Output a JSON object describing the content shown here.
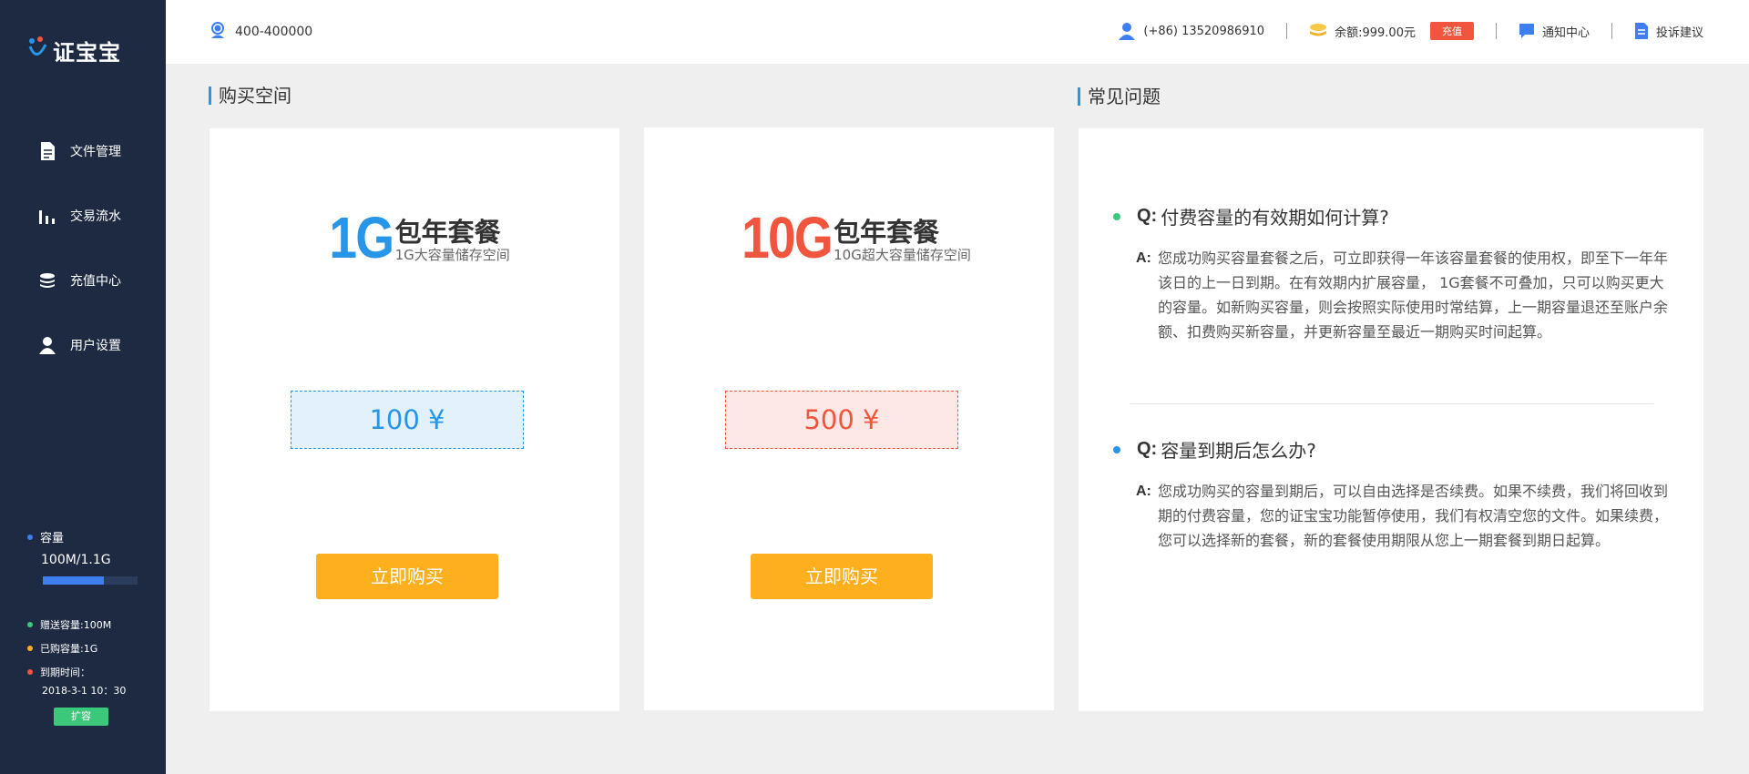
{
  "brand": {
    "name": "证宝宝"
  },
  "sidebar": {
    "items": [
      {
        "label": "文件管理",
        "icon": "document-icon"
      },
      {
        "label": "交易流水",
        "icon": "bar-chart-icon"
      },
      {
        "label": "充值中心",
        "icon": "coins-icon"
      },
      {
        "label": "用户设置",
        "icon": "user-icon"
      }
    ],
    "capacity": {
      "title": "容量",
      "value": "100M/1.1G",
      "used_fraction": 0.64,
      "gift": "赠送容量:100M",
      "purchased": "已购容量:1G",
      "expire_label": "到期时间：",
      "expire_value": "2018-3-1 10：30",
      "expand_label": "扩容"
    },
    "colors": {
      "background": "#1e2a42",
      "gift_dot": "#3cc87a",
      "purchased_dot": "#fdaf1d",
      "expire_dot": "#f2553d",
      "capacity_dot": "#3e7ef0"
    }
  },
  "header": {
    "hotline": "400-400000",
    "phone": "(+86)  13520986910",
    "balance": "余额:999.00元",
    "recharge_label": "充值",
    "notifications": "通知中心",
    "feedback": "投诉建议"
  },
  "purchase": {
    "title": "购买空间",
    "plans": [
      {
        "size": "1G",
        "name": "包年套餐",
        "desc": "1G大容量储存空间",
        "price": "100 ¥",
        "button": "立即购买",
        "color": "#2796e8"
      },
      {
        "size": "10G",
        "name": "包年套餐",
        "desc": "10G超大容量储存空间",
        "price": "500 ¥",
        "button": "立即购买",
        "color": "#f2553d"
      }
    ]
  },
  "faq": {
    "title": "常见问题",
    "items": [
      {
        "q_key": "Q:",
        "question": "付费容量的有效期如何计算?",
        "a_key": "A:",
        "answer": "您成功购买容量套餐之后，可立即获得一年该容量套餐的使用权，即至下一年年该日的上一日到期。在有效期内扩展容量， 1G套餐不可叠加，只可以购买更大的容量。如新购买容量，则会按照实际使用时常结算，上一期容量退还至账户余额、扣费购买新容量，并更新容量至最近一期购买时间起算。",
        "dot_color": "#3cc87a"
      },
      {
        "q_key": "Q:",
        "question": "容量到期后怎么办?",
        "a_key": "A:",
        "answer": "您成功购买的容量到期后，可以自由选择是否续费。如果不续费，我们将回收到期的付费容量，您的证宝宝功能暂停使用，我们有权清空您的文件。如果续费，您可以选择新的套餐，新的套餐使用期限从您上一期套餐到期日起算。",
        "dot_color": "#2796e8"
      }
    ]
  }
}
